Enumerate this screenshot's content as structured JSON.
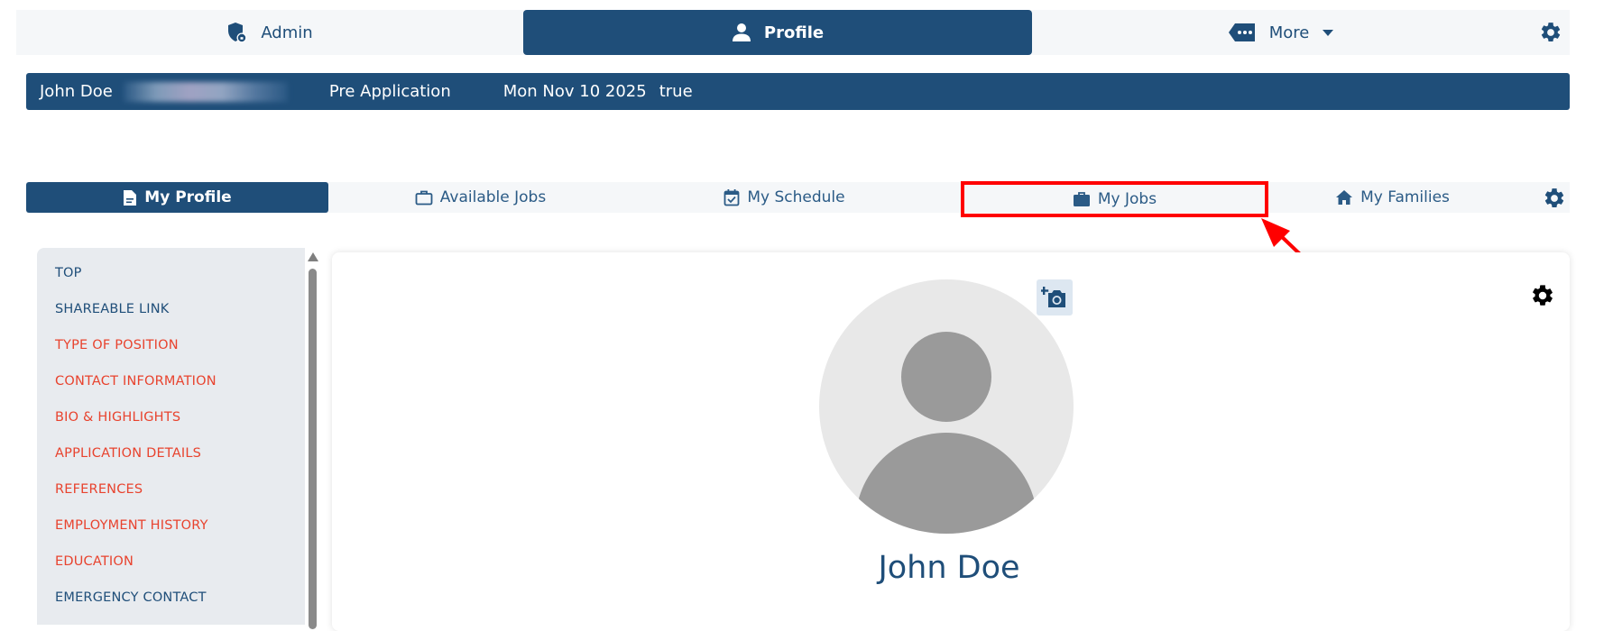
{
  "topnav": {
    "admin_label": "Admin",
    "profile_label": "Profile",
    "more_label": "More",
    "icons": {
      "admin": "shield-icon",
      "profile": "person-icon",
      "more": "tag-icon",
      "dropdown": "caret-down-icon",
      "settings": "gear-icon"
    }
  },
  "infobar": {
    "name": "John Doe",
    "stage": "Pre Application",
    "date": "Mon Nov 10 2025",
    "flag": "true"
  },
  "subnav": {
    "tabs": [
      {
        "label": "My Profile",
        "icon": "document-icon"
      },
      {
        "label": "Available Jobs",
        "icon": "briefcase-outline-icon"
      },
      {
        "label": "My Schedule",
        "icon": "calendar-check-icon"
      },
      {
        "label": "My Jobs",
        "icon": "briefcase-icon"
      },
      {
        "label": "My Families",
        "icon": "house-icon"
      }
    ]
  },
  "sidebar": {
    "items": [
      {
        "label": "TOP",
        "status": "blue"
      },
      {
        "label": "SHAREABLE LINK",
        "status": "blue"
      },
      {
        "label": "TYPE OF POSITION",
        "status": "red"
      },
      {
        "label": "CONTACT INFORMATION",
        "status": "red"
      },
      {
        "label": "BIO & HIGHLIGHTS",
        "status": "red"
      },
      {
        "label": "APPLICATION DETAILS",
        "status": "red"
      },
      {
        "label": "REFERENCES",
        "status": "red"
      },
      {
        "label": "EMPLOYMENT HISTORY",
        "status": "red"
      },
      {
        "label": "EDUCATION",
        "status": "red"
      },
      {
        "label": "EMERGENCY CONTACT",
        "status": "blue"
      }
    ]
  },
  "profile": {
    "name": "John Doe"
  },
  "colors": {
    "navy": "#1f4e79",
    "alert_red": "#e8432e",
    "highlight": "#ff0000",
    "nav_bg": "#f5f7f9",
    "sidebar_bg": "#e8ebef"
  }
}
